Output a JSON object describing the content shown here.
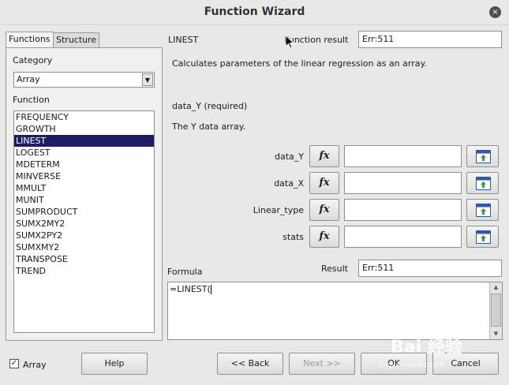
{
  "window": {
    "title": "Function Wizard",
    "close_icon": "×"
  },
  "tabs": [
    {
      "label": "Functions"
    },
    {
      "label": "Structure"
    }
  ],
  "category": {
    "label": "Category",
    "value": "Array"
  },
  "function_list": {
    "label": "Function",
    "items": [
      "FREQUENCY",
      "GROWTH",
      "LINEST",
      "LOGEST",
      "MDETERM",
      "MINVERSE",
      "MMULT",
      "MUNIT",
      "SUMPRODUCT",
      "SUMX2MY2",
      "SUMX2PY2",
      "SUMXMY2",
      "TRANSPOSE",
      "TREND"
    ],
    "selected": "LINEST"
  },
  "detail": {
    "function_name": "LINEST",
    "function_result_label": "Function result",
    "function_result_value": "Err:511",
    "description": "Calculates parameters of the linear regression as an array.",
    "param_title": "data_Y (required)",
    "param_description": "The Y data array."
  },
  "arguments": [
    {
      "label": "data_Y",
      "fx": "fx",
      "value": ""
    },
    {
      "label": "data_X",
      "fx": "fx",
      "value": ""
    },
    {
      "label": "Linear_type",
      "fx": "fx",
      "value": ""
    },
    {
      "label": "stats",
      "fx": "fx",
      "value": ""
    }
  ],
  "formula": {
    "label": "Formula",
    "value": "=LINEST(",
    "result_label": "Result",
    "result_value": "Err:511"
  },
  "footer": {
    "array_label": "Array",
    "array_checked": "✓",
    "help": "Help",
    "back": "<< Back",
    "next": "Next >>",
    "ok": "OK",
    "cancel": "Cancel"
  },
  "watermark": {
    "main": "Bai 经验",
    "sub": "jingyan.baidu.com"
  }
}
